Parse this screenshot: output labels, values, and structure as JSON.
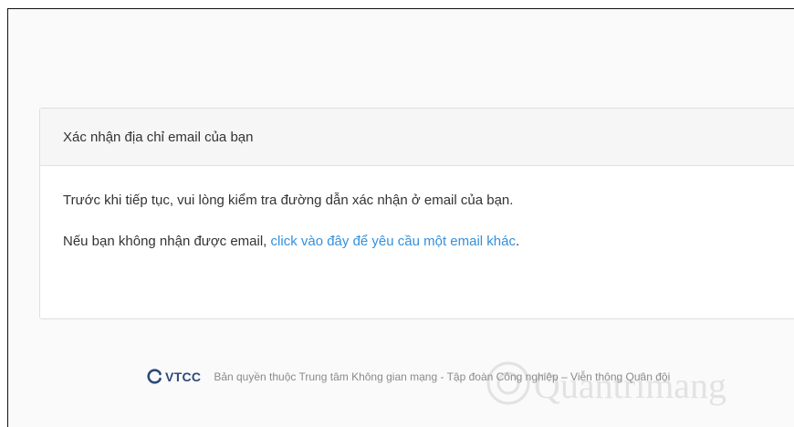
{
  "card": {
    "title": "Xác nhận địa chỉ email của bạn",
    "message": "Trước khi tiếp tục, vui lòng kiểm tra đường dẫn xác nhận ở email của bạn.",
    "resend_prefix": "Nếu bạn không nhận được email, ",
    "resend_link": "click vào đây để yêu cầu một email khác",
    "resend_suffix": "."
  },
  "footer": {
    "logo_text": "VTCC",
    "copyright": "Bản quyền thuộc Trung tâm Không gian mạng - Tập đoàn Công nghiệp – Viễn thông Quân đội"
  },
  "watermark": {
    "text": "Quantrimang"
  },
  "colors": {
    "link": "#3490dc",
    "logo": "#2c4a78",
    "text": "#333333",
    "footer_text": "#8a8a8a"
  }
}
